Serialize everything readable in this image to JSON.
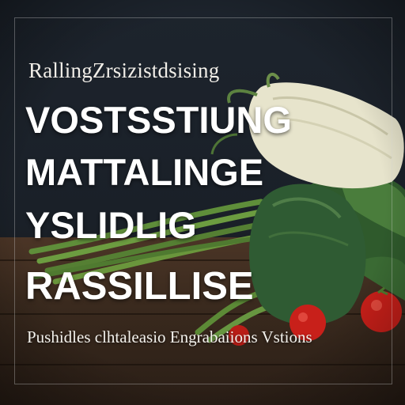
{
  "poster": {
    "subtitle": "RallingZrsizistdsising",
    "headline_lines": [
      "VOSTSSTIUNG",
      "MATTALINGE",
      "YSLIDLIG",
      "RASSILLISE"
    ],
    "tagline": "Pushidles clhtaleasio Engrabaiions Vstions"
  },
  "colors": {
    "background": "#1b2129",
    "table": "#3a2a1e",
    "fennel": "#e8e6cf",
    "greens": "#3f6b35",
    "tomato": "#c8201a",
    "text": "#ffffff"
  },
  "illustration": {
    "items": [
      "fennel-bulb",
      "green-beans",
      "zucchini",
      "leafy-greens",
      "cherry-tomatoes",
      "wooden-table"
    ]
  }
}
